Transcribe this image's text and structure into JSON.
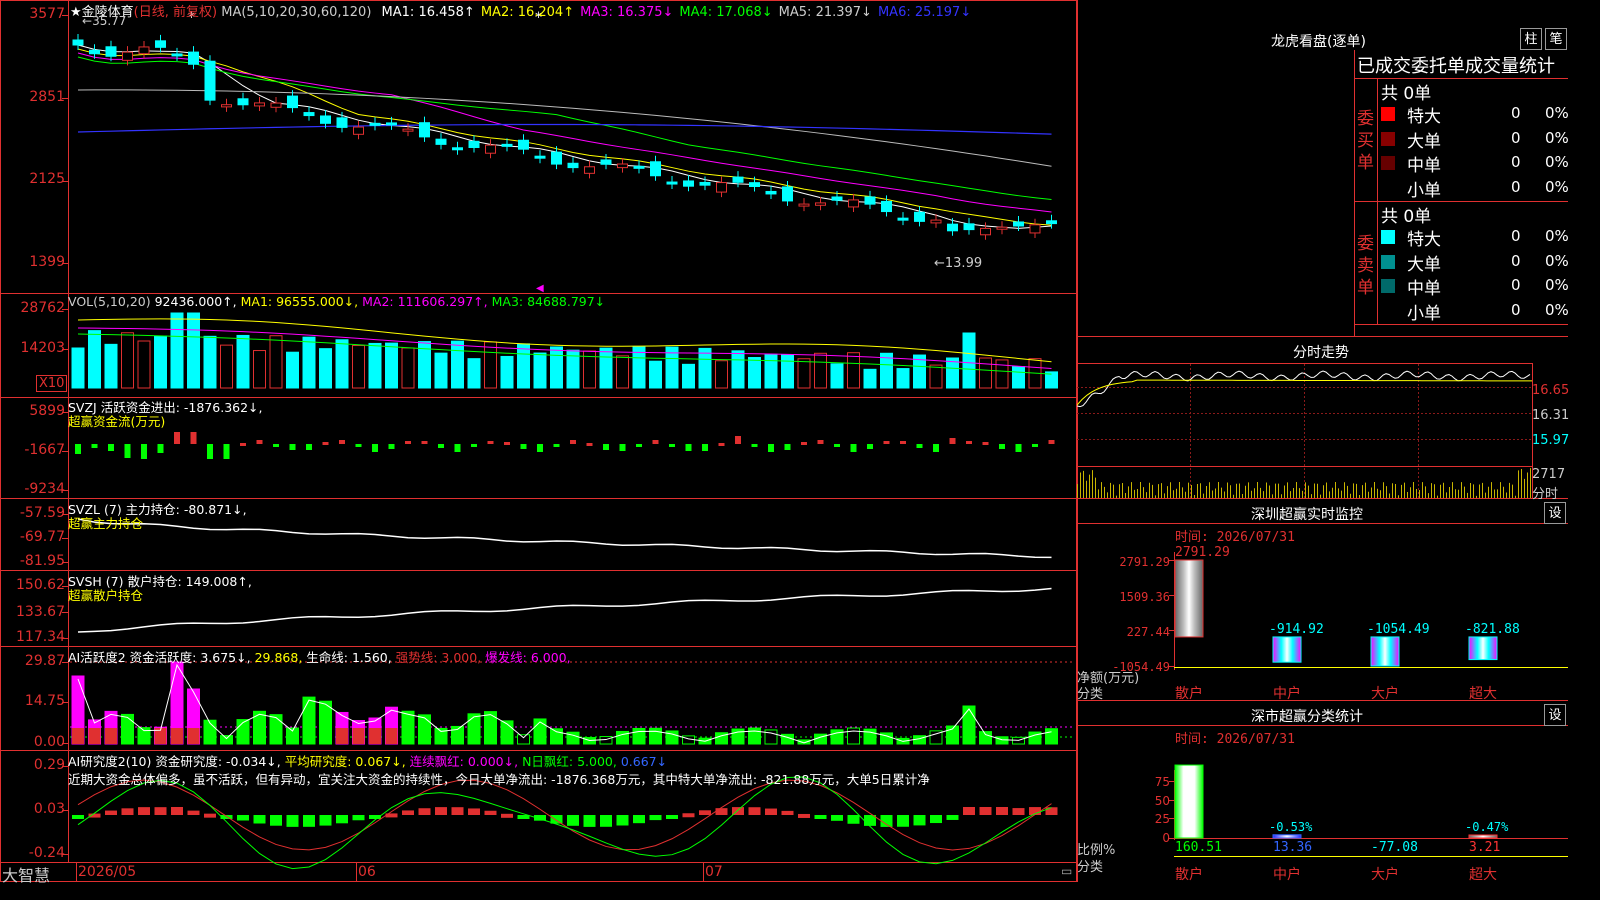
{
  "main": {
    "stock": {
      "name": "金陵体育",
      "period": "(日线, 前复权)",
      "ma_prefix": "MA(5,10,20,30,60,120)"
    },
    "ma": [
      {
        "t": "MA1: 16.458↑",
        "c": "#ffffff"
      },
      {
        "t": "MA2: 16.204↑",
        "c": "#ffff00"
      },
      {
        "t": "MA3: 16.375↓",
        "c": "#ff00ff"
      },
      {
        "t": "MA4: 17.068↓",
        "c": "#00ff00"
      },
      {
        "t": "MA5: 21.397↓",
        "c": "#cccccc"
      },
      {
        "t": "MA6: 25.197↓",
        "c": "#3333ff"
      }
    ],
    "price_axis": [
      "3577",
      "2851",
      "2125",
      "1399"
    ],
    "high_note": "35.77",
    "low_note": "←13.99",
    "vol": {
      "label": "VOL(5,10,20)",
      "val": "92436.000↑,",
      "ma1": "MA1: 96555.000↓,",
      "ma2": "MA2: 111606.297↑,",
      "ma3": "MA3: 84688.797↓",
      "axis": [
        "28762",
        "14203"
      ],
      "unit": "X10"
    },
    "svzj": {
      "label": "SVZJ  活跃资金进出: -1876.362↓,",
      "sub": "超赢资金流(万元)",
      "axis": [
        "5899",
        "-1667",
        "-9234"
      ]
    },
    "svzl": {
      "label": "SVZL (7) 主力持仓: -80.871↓,",
      "sub": "超赢主力持仓",
      "axis": [
        "-57.59",
        "-69.77",
        "-81.95"
      ]
    },
    "svsh": {
      "label": "SVSH (7) 散户持仓: 149.008↑,",
      "sub": "超赢散户持仓",
      "axis": [
        "150.62",
        "133.67",
        "117.34"
      ]
    },
    "ai1": {
      "l1": "AI活跃度2 资金活跃度: 3.675↓,",
      "l2": "29.868,",
      "l3": "生命线: 1.560,",
      "l4": "强势线: 3.000,",
      "l5": "爆发线: 6.000,",
      "axis": [
        "29.87",
        "14.75",
        "0.00"
      ]
    },
    "ai2": {
      "l1": "AI研究度2(10) 资金研究度: -0.034↓,",
      "l2": "平均研究度: 0.067↓,",
      "l3": "连续飘红: 0.000↓,",
      "l4": "N日飘红: 5.000,",
      "l5": "0.667↓",
      "axis": [
        "0.29",
        "0.03",
        "-0.24"
      ]
    },
    "ticker": "近期大资金总体偏多，虽不活跃，但有异动，宜关注大资金的持续性，今日大单净流出: -1876.368万元，其中特大单净流出: -821.88万元，大单5日累计净",
    "dates": [
      "2026/05",
      "06",
      "07"
    ],
    "brand": "大智慧"
  },
  "side": {
    "lhb": {
      "title": "龙虎看盘(逐单)",
      "btn1": "柱",
      "btn2": "笔",
      "header": "已成交委托单成交量统计",
      "buy": {
        "label": "委买单",
        "total": "共 0单",
        "rows": [
          {
            "n": "特大",
            "v": "0",
            "p": "0%",
            "c": "#ff0000"
          },
          {
            "n": "大单",
            "v": "0",
            "p": "0%",
            "c": "#880000"
          },
          {
            "n": "中单",
            "v": "0",
            "p": "0%",
            "c": "#660000"
          },
          {
            "n": "小单",
            "v": "0",
            "p": "0%",
            "c": ""
          }
        ]
      },
      "sell": {
        "label": "委卖单",
        "total": "共 0单",
        "rows": [
          {
            "n": "特大",
            "v": "0",
            "p": "0%",
            "c": "#00ffff"
          },
          {
            "n": "大单",
            "v": "0",
            "p": "0%",
            "c": "#009090"
          },
          {
            "n": "中单",
            "v": "0",
            "p": "0%",
            "c": "#006a6a"
          },
          {
            "n": "小单",
            "v": "0",
            "p": "0%",
            "c": ""
          }
        ]
      }
    },
    "intraday": {
      "title": "分时走势",
      "axis": [
        "16.65",
        "16.31",
        "15.97"
      ],
      "vol": "2717",
      "unit": "分时"
    },
    "monitor": {
      "title": "深圳超赢实时监控",
      "btn": "设",
      "time": "时间: 2026/07/31",
      "axis": [
        "2791.29",
        "1509.36",
        "227.44",
        "-1054.49"
      ],
      "bars": [
        {
          "v": 2791.29,
          "label": "2791.29"
        },
        {
          "v": -914.92,
          "label": "-914.92"
        },
        {
          "v": -1054.49,
          "label": "-1054.49"
        },
        {
          "v": -821.88,
          "label": "-821.88"
        }
      ],
      "y_unit": "净额(万元)",
      "x_unit": "分类",
      "cats": [
        "散户",
        "中户",
        "大户",
        "超大"
      ]
    },
    "classify": {
      "title": "深市超赢分类统计",
      "btn": "设",
      "time": "时间: 2026/07/31",
      "axis": [
        "75",
        "50",
        "25",
        "0"
      ],
      "bars": [
        {
          "v": 75,
          "label": ""
        },
        {
          "v": 0.53,
          "label": "-0.53%"
        },
        {
          "v": 0,
          "label": ""
        },
        {
          "v": 0.47,
          "label": "-0.47%"
        }
      ],
      "vals": [
        "160.51",
        "13.36",
        "-77.08",
        "3.21"
      ],
      "y_unit": "比例%",
      "x_unit": "分类",
      "cats": [
        "散户",
        "中户",
        "大户",
        "超大"
      ]
    }
  }
}
